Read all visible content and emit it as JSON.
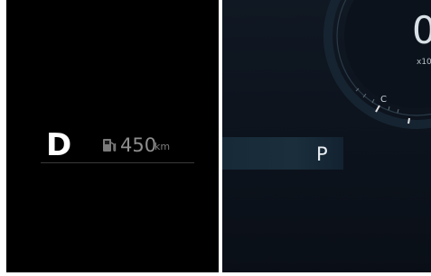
{
  "left_display": {
    "gear": "D",
    "fuel_icon": "fuel-pump-icon",
    "range_value": "450",
    "range_unit": "km"
  },
  "right_display": {
    "gear": "P",
    "speed_partial": "0",
    "rpm_scale_partial": "x10",
    "temp_label": "C"
  },
  "colors": {
    "left_background": "#000000",
    "right_background": "#0d141e",
    "gear_band": "#1a2e3c",
    "text_primary": "#ffffff",
    "text_muted": "#8e8e8e",
    "warning_tick": "#e0e0e0"
  }
}
